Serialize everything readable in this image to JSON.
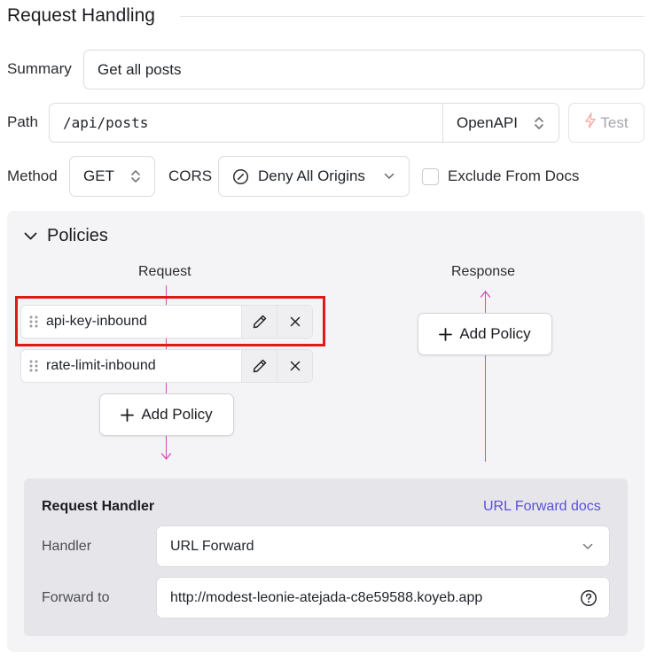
{
  "section": {
    "title": "Request Handling"
  },
  "summary": {
    "label": "Summary",
    "value": "Get all posts"
  },
  "path": {
    "label": "Path",
    "value": "/api/posts",
    "spec_select": "OpenAPI",
    "test_label": "Test"
  },
  "method": {
    "label": "Method",
    "value": "GET"
  },
  "cors": {
    "label": "CORS",
    "value": "Deny All Origins"
  },
  "exclude": {
    "label": "Exclude From Docs",
    "checked": false
  },
  "policies": {
    "title": "Policies",
    "request_label": "Request",
    "response_label": "Response",
    "request_items": [
      {
        "name": "api-key-inbound"
      },
      {
        "name": "rate-limit-inbound"
      }
    ],
    "add_policy_label": "Add Policy"
  },
  "handler": {
    "title": "Request Handler",
    "docs_link": "URL Forward docs",
    "handler_label": "Handler",
    "handler_value": "URL Forward",
    "forward_label": "Forward to",
    "forward_value": "http://modest-leonie-atejada-c8e59588.koyeb.app"
  },
  "colors": {
    "flow_line": "#d946b8",
    "link": "#5a4fd6",
    "highlight": "#e01919"
  }
}
